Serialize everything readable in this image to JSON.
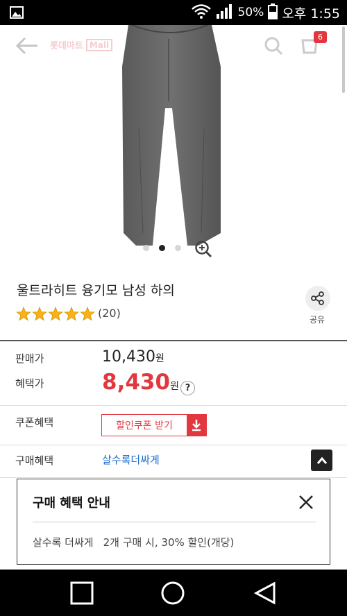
{
  "status_bar": {
    "battery_percent": "50%",
    "time": "오후 1:55",
    "icons": [
      "image-icon",
      "wifi-icon",
      "signal-icon",
      "battery-icon"
    ]
  },
  "top_nav": {
    "logo_text": "롯데마트",
    "logo_badge": "Mall",
    "cart_count": "6",
    "icons": [
      "back-arrow-icon",
      "search-icon",
      "cart-icon"
    ]
  },
  "gallery": {
    "image_count": 3,
    "active_index": 1,
    "zoom_icon": "zoom-in-icon"
  },
  "product": {
    "title": "울트라히트 융기모 남성 하의",
    "rating": 5,
    "review_count": "(20)",
    "share_label": "공유"
  },
  "pricing": {
    "sale_label": "판매가",
    "sale_price": "10,430",
    "sale_unit": "원",
    "benefit_label": "혜택가",
    "benefit_price": "8,430",
    "benefit_unit": "원",
    "help_label": "?"
  },
  "coupon": {
    "label": "쿠폰혜택",
    "button_label": "할인쿠폰 받기"
  },
  "purchase_benefit": {
    "label": "구매혜택",
    "link_text": "살수록더싸게"
  },
  "popup": {
    "title": "구매 혜택 안내",
    "benefit_name": "살수록 더싸게",
    "benefit_detail": "2개 구매 시, 30% 할인(개당)"
  },
  "colors": {
    "accent": "#e2373f",
    "link": "#1b6bd1"
  }
}
